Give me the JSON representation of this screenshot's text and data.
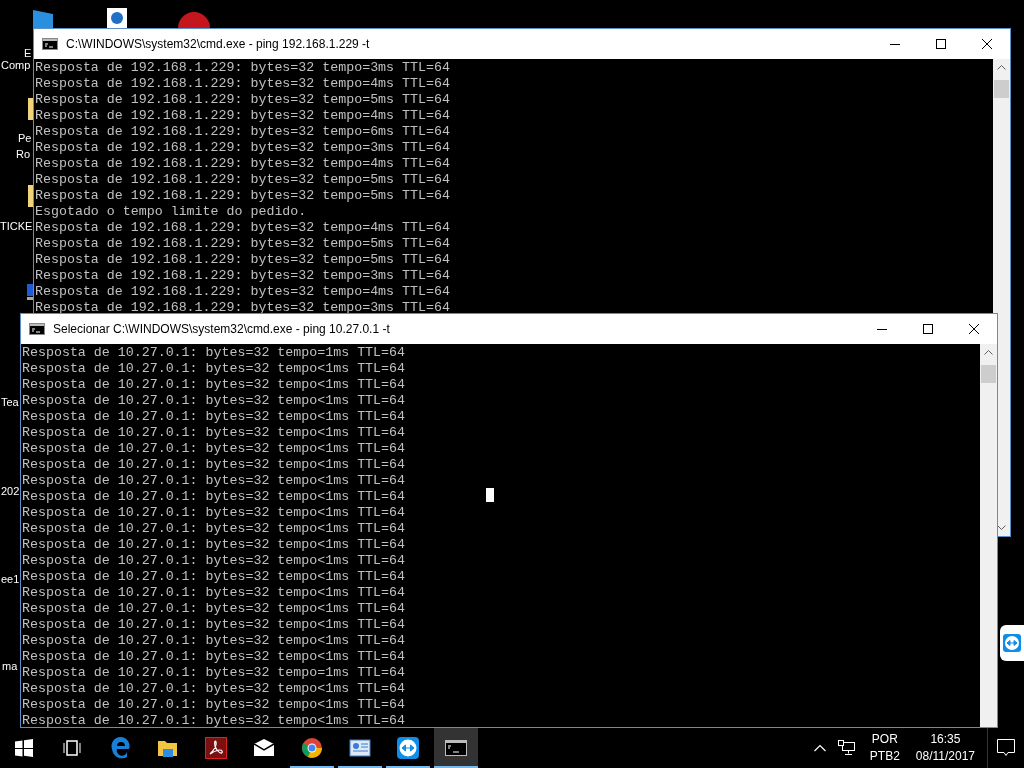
{
  "desktop_icons": [
    {
      "label": "E"
    },
    {
      "label": "Comp"
    },
    {
      "label": "Pe"
    },
    {
      "label": "Ro"
    },
    {
      "label": "TICKE"
    },
    {
      "label": "Tea"
    },
    {
      "label": "202"
    },
    {
      "label": "ee1"
    },
    {
      "label": "ma"
    }
  ],
  "windows": [
    {
      "title": "C:\\WINDOWS\\system32\\cmd.exe - ping  192.168.1.229 -t",
      "lines": [
        "Resposta de 192.168.1.229: bytes=32 tempo=3ms TTL=64",
        "Resposta de 192.168.1.229: bytes=32 tempo=4ms TTL=64",
        "Resposta de 192.168.1.229: bytes=32 tempo=5ms TTL=64",
        "Resposta de 192.168.1.229: bytes=32 tempo=4ms TTL=64",
        "Resposta de 192.168.1.229: bytes=32 tempo=6ms TTL=64",
        "Resposta de 192.168.1.229: bytes=32 tempo=3ms TTL=64",
        "Resposta de 192.168.1.229: bytes=32 tempo=4ms TTL=64",
        "Resposta de 192.168.1.229: bytes=32 tempo=5ms TTL=64",
        "Resposta de 192.168.1.229: bytes=32 tempo=5ms TTL=64",
        "Esgotado o tempo limite do pedido.",
        "Resposta de 192.168.1.229: bytes=32 tempo=4ms TTL=64",
        "Resposta de 192.168.1.229: bytes=32 tempo=5ms TTL=64",
        "Resposta de 192.168.1.229: bytes=32 tempo=5ms TTL=64",
        "Resposta de 192.168.1.229: bytes=32 tempo=3ms TTL=64",
        "Resposta de 192.168.1.229: bytes=32 tempo=4ms TTL=64",
        "Resposta de 192.168.1.229: bytes=32 tempo=3ms TTL=64"
      ]
    },
    {
      "title": "Selecionar C:\\WINDOWS\\system32\\cmd.exe - ping  10.27.0.1 -t",
      "lines": [
        "Resposta de 10.27.0.1: bytes=32 tempo=1ms TTL=64",
        "Resposta de 10.27.0.1: bytes=32 tempo<1ms TTL=64",
        "Resposta de 10.27.0.1: bytes=32 tempo<1ms TTL=64",
        "Resposta de 10.27.0.1: bytes=32 tempo<1ms TTL=64",
        "Resposta de 10.27.0.1: bytes=32 tempo<1ms TTL=64",
        "Resposta de 10.27.0.1: bytes=32 tempo<1ms TTL=64",
        "Resposta de 10.27.0.1: bytes=32 tempo<1ms TTL=64",
        "Resposta de 10.27.0.1: bytes=32 tempo<1ms TTL=64",
        "Resposta de 10.27.0.1: bytes=32 tempo<1ms TTL=64",
        "Resposta de 10.27.0.1: bytes=32 tempo<1ms TTL=64",
        "Resposta de 10.27.0.1: bytes=32 tempo<1ms TTL=64",
        "Resposta de 10.27.0.1: bytes=32 tempo<1ms TTL=64",
        "Resposta de 10.27.0.1: bytes=32 tempo<1ms TTL=64",
        "Resposta de 10.27.0.1: bytes=32 tempo<1ms TTL=64",
        "Resposta de 10.27.0.1: bytes=32 tempo<1ms TTL=64",
        "Resposta de 10.27.0.1: bytes=32 tempo<1ms TTL=64",
        "Resposta de 10.27.0.1: bytes=32 tempo<1ms TTL=64",
        "Resposta de 10.27.0.1: bytes=32 tempo<1ms TTL=64",
        "Resposta de 10.27.0.1: bytes=32 tempo<1ms TTL=64",
        "Resposta de 10.27.0.1: bytes=32 tempo<1ms TTL=64",
        "Resposta de 10.27.0.1: bytes=32 tempo=1ms TTL=64",
        "Resposta de 10.27.0.1: bytes=32 tempo<1ms TTL=64",
        "Resposta de 10.27.0.1: bytes=32 tempo<1ms TTL=64",
        "Resposta de 10.27.0.1: bytes=32 tempo<1ms TTL=64"
      ]
    }
  ],
  "taskbar": {
    "apps": [
      {
        "kind": "start",
        "active": false,
        "running": false
      },
      {
        "kind": "taskview",
        "active": false,
        "running": false
      },
      {
        "kind": "edge",
        "active": false,
        "running": false
      },
      {
        "kind": "explorer",
        "active": false,
        "running": false
      },
      {
        "kind": "pdf",
        "active": false,
        "running": false
      },
      {
        "kind": "mail",
        "active": false,
        "running": false
      },
      {
        "kind": "chrome",
        "active": false,
        "running": true
      },
      {
        "kind": "app",
        "active": false,
        "running": true
      },
      {
        "kind": "remote",
        "active": false,
        "running": true
      },
      {
        "kind": "console",
        "active": true,
        "running": true
      }
    ],
    "language": "POR",
    "layout": "PTB2",
    "time": "16:35",
    "date": "08/11/2017"
  }
}
